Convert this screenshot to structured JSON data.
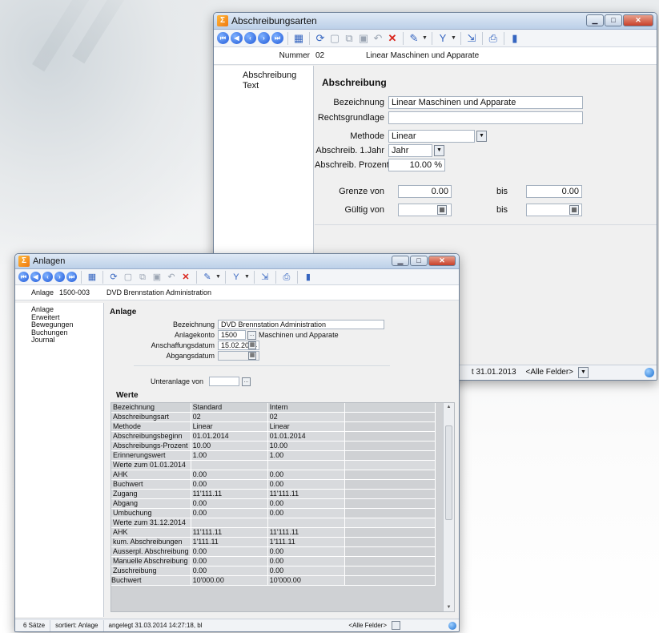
{
  "win1": {
    "title": "Abschreibungsarten",
    "nummer_label": "Nummer",
    "nummer_value": "02",
    "nummer_desc": "Linear Maschinen und Apparate",
    "nav": [
      "Abschreibung",
      "Text"
    ],
    "section": "Abschreibung",
    "labels": {
      "bezeichnung": "Bezeichnung",
      "rechtsgrundlage": "Rechtsgrundlage",
      "methode": "Methode",
      "jahr1": "Abschreib. 1.Jahr",
      "prozent": "Abschreib. Prozent",
      "grenze": "Grenze von",
      "gueltig": "Gültig von",
      "bis": "bis"
    },
    "values": {
      "bezeichnung": "Linear Maschinen und Apparate",
      "rechtsgrundlage": "",
      "methode": "Linear",
      "jahr1": "Jahr",
      "prozent": "10.00 %",
      "grenze_von": "0.00",
      "grenze_bis": "0.00",
      "gueltig_von": "",
      "gueltig_bis": ""
    },
    "status_date": "t 31.01.2013",
    "status_filter": "<Alle Felder>"
  },
  "win2": {
    "title": "Anlagen",
    "anlage_label": "Anlage",
    "anlage_value": "1500-003",
    "anlage_desc": "DVD Brennstation Administration",
    "nav": [
      "Anlage",
      "Erweitert",
      "Bewegungen",
      "Buchungen",
      "Journal"
    ],
    "section": "Anlage",
    "labels": {
      "bezeichnung": "Bezeichnung",
      "anlagekonto": "Anlagekonto",
      "anschaffung": "Anschaffungsdatum",
      "abgang": "Abgangsdatum",
      "unteranlage": "Unteranlage von"
    },
    "values": {
      "bezeichnung": "DVD Brennstation Administration",
      "anlagekonto": "1500",
      "anlagekonto_desc": "Maschinen und Apparate",
      "anschaffung": "15.02.2014",
      "abgang": "",
      "unteranlage": ""
    },
    "werte_title": "Werte",
    "werte_rows": [
      [
        "Bezeichnung",
        "Standard",
        "Intern"
      ],
      [
        "Abschreibungsart",
        "02",
        "02"
      ],
      [
        "Methode",
        "Linear",
        "Linear"
      ],
      [
        "Abschreibungsbeginn",
        "01.01.2014",
        "01.01.2014"
      ],
      [
        "Abschreibungs-Prozent",
        "10.00",
        "10.00"
      ],
      [
        "Erinnerungswert",
        "1.00",
        "1.00"
      ],
      [
        "Werte zum 01.01.2014",
        "",
        ""
      ],
      [
        "AHK",
        "0.00",
        "0.00"
      ],
      [
        "Buchwert",
        "0.00",
        "0.00"
      ],
      [
        "Zugang",
        "11'111.11",
        "11'111.11"
      ],
      [
        "Abgang",
        "0.00",
        "0.00"
      ],
      [
        "Umbuchung",
        "0.00",
        "0.00"
      ],
      [
        "Werte zum 31.12.2014",
        "",
        ""
      ],
      [
        "AHK",
        "11'111.11",
        "11'111.11"
      ],
      [
        "kum. Abschreibungen",
        "1'111.11",
        "1'111.11"
      ],
      [
        "Ausserpl. Abschreibung",
        "0.00",
        "0.00"
      ],
      [
        "Manuelle Abschreibung",
        "0.00",
        "0.00"
      ],
      [
        "Zuschreibung",
        "0.00",
        "0.00"
      ],
      [
        "Buchwert",
        "10'000.00",
        "10'000.00"
      ]
    ],
    "status": {
      "saetze": "6 Sätze",
      "sortiert": "sortiert: Anlage",
      "angelegt": "angelegt 31.03.2014 14:27:18, bl",
      "filter": "<Alle Felder>"
    }
  }
}
